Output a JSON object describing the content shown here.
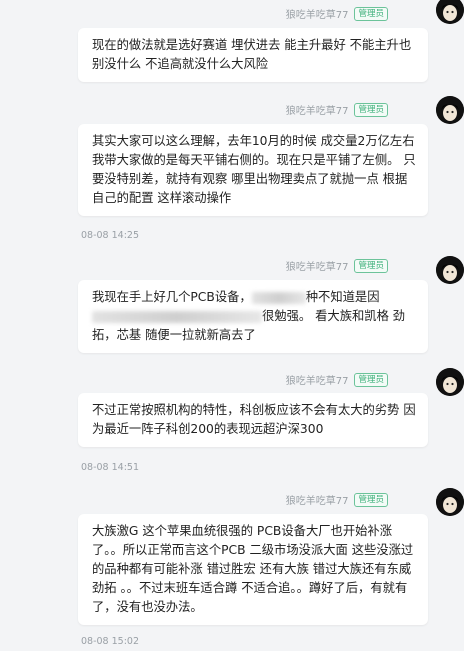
{
  "messages": [
    {
      "username": "狼吃羊吃草77",
      "badge": "管理员",
      "text": "现在的做法就是选好赛道 埋伏进去 能主升最好 不能主升也别没什么 不追高就没什么大风险",
      "timestamp": ""
    },
    {
      "username": "狼吃羊吃草77",
      "badge": "管理员",
      "text": "其实大家可以这么理解，去年10月的时候 成交量2万亿左右 我带大家做的是每天平铺右侧的。现在只是平铺了左侧。  只要没特别差，就持有观察 哪里出物理卖点了就抛一点  根据自己的配置  这样滚动操作",
      "timestamp": "08-08 14:25"
    },
    {
      "username": "狼吃羊吃草77",
      "badge": "管理员",
      "text_before_redaction": "我现在手上好几个PCB设备，",
      "text_mid": "种不知道是因",
      "text_after_redaction_2": "很勉强。 看大族和凯格 劲拓，芯基 随便一拉就新高去了",
      "timestamp": ""
    },
    {
      "username": "狼吃羊吃草77",
      "badge": "管理员",
      "text": "不过正常按照机构的特性，科创板应该不会有太大的劣势 因为最近一阵子科创200的表现远超沪深300",
      "timestamp": "08-08 14:51"
    },
    {
      "username": "狼吃羊吃草77",
      "badge": "管理员",
      "text": "大族激G 这个苹果血统很强的 PCB设备大厂也开始补涨了。。所以正常而言这个PCB 二级市场没派大面 这些没涨过的品种都有可能补涨  错过胜宏 还有大族  错过大族还有东威 劲拓 。。不过末班车适合蹲 不适合追。。蹲好了后，有就有了，没有也没办法。",
      "timestamp": "08-08 15:02"
    }
  ],
  "colors": {
    "accent": "#3fb07b",
    "background": "#f3f4f6",
    "bubble": "#ffffff"
  }
}
